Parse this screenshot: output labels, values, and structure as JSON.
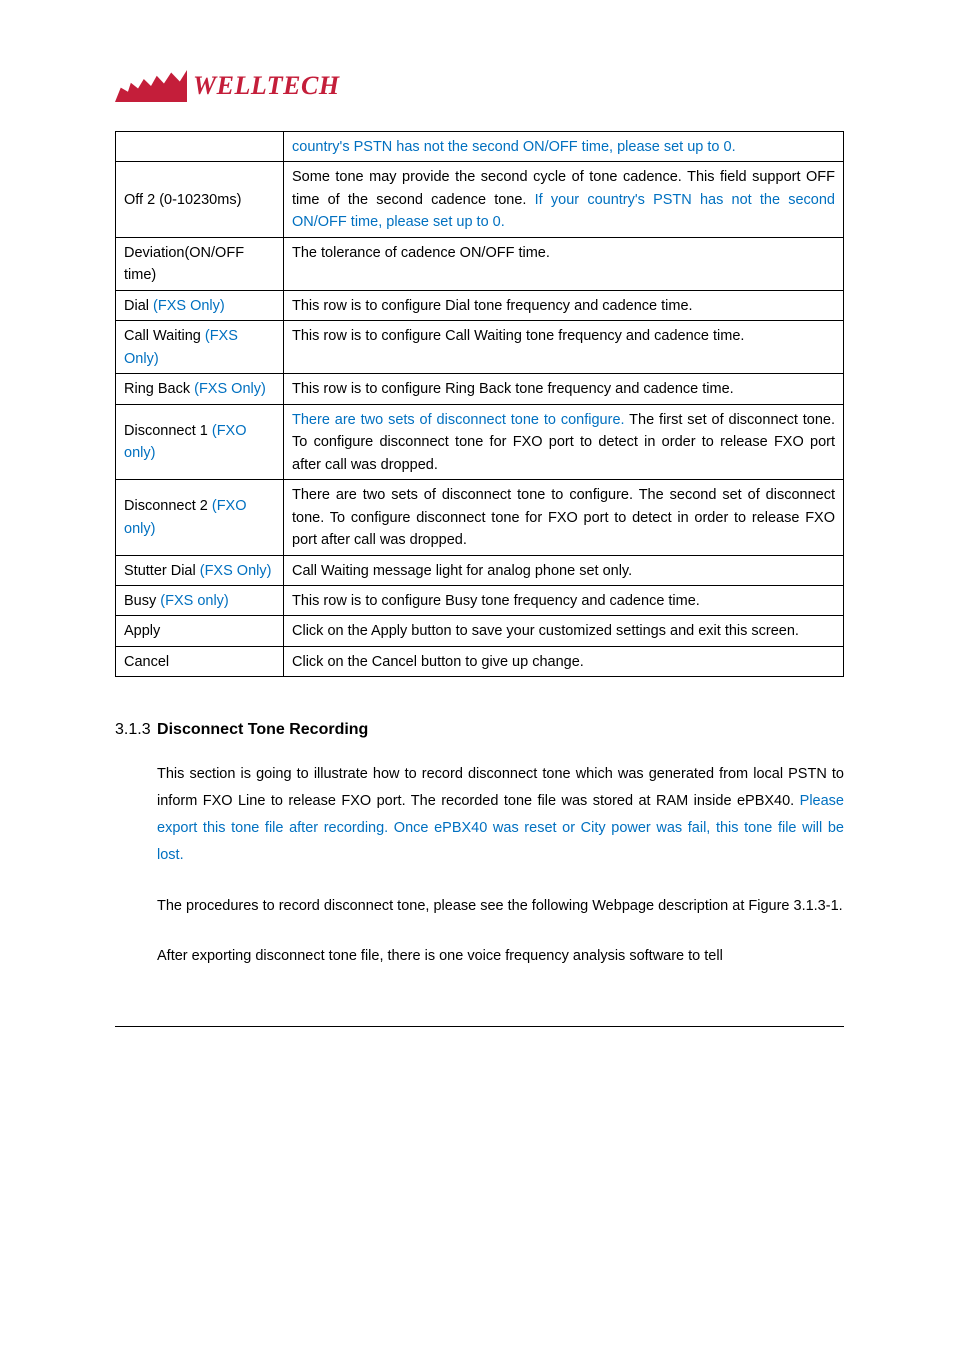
{
  "logo": {
    "text": "WELLTECH"
  },
  "table": {
    "rows": [
      {
        "label_html": "",
        "desc_html": "<span class='blue'>country's PSTN has not the second ON/OFF time, please set up to 0.</span>"
      },
      {
        "label_html": "Off 2 (0-10230ms)",
        "desc_html": "Some tone may provide the second cycle of tone cadence. This field support OFF time of the second cadence tone. <span class='blue'>If your country's PSTN has not the second ON/OFF time, please set up to 0.</span>"
      },
      {
        "label_html": "Deviation(ON/OFF time)",
        "desc_html": "The tolerance of cadence ON/OFF time."
      },
      {
        "label_html": "Dial <span class='blue'>(FXS Only)</span>",
        "desc_html": "This row is to configure Dial tone frequency and cadence time."
      },
      {
        "label_html": "Call Waiting <span class='blue'>(FXS Only)</span>",
        "desc_html": "This row is to configure Call Waiting tone frequency and cadence time."
      },
      {
        "label_html": "Ring Back <span class='blue'>(FXS Only)</span>",
        "desc_html": "This row is to configure Ring Back tone frequency and cadence time."
      },
      {
        "label_html": "Disconnect 1 <span class='blue'>(FXO only)</span>",
        "desc_html": "<span class='blue'>There are two sets of disconnect tone to configure.</span> The first set of disconnect tone. To configure disconnect tone for FXO port to detect in order to release FXO port after call was dropped."
      },
      {
        "label_html": "Disconnect 2 <span class='blue'>(FXO only)</span>",
        "desc_html": "There are two sets of disconnect tone to configure. The second set of disconnect tone. To configure disconnect tone for FXO port to detect in order to release FXO port after call was dropped."
      },
      {
        "label_html": "Stutter Dial <span class='blue'>(FXS Only)</span>",
        "desc_html": "Call Waiting message light for analog phone set only."
      },
      {
        "label_html": "Busy <span class='blue'>(FXS only)</span>",
        "desc_html": "This row is to configure Busy tone frequency and cadence time."
      },
      {
        "label_html": "Apply",
        "desc_html": "Click on the Apply button to save your customized settings and exit this screen."
      },
      {
        "label_html": "Cancel",
        "desc_html": "Click on the Cancel button to give up change."
      }
    ]
  },
  "heading": {
    "num": "3.1.3",
    "title": "Disconnect Tone Recording"
  },
  "para1_html": "This section is going to illustrate how to record disconnect tone which was generated from local PSTN to inform FXO Line to release FXO port. The recorded tone file was stored at RAM inside ePBX40. <span class='blue'>Please export this tone file after recording. Once ePBX40 was reset or City power was fail, this tone file will be lost.</span>",
  "para2": "The procedures to record disconnect tone, please see the following Webpage description at Figure 3.1.3-1.",
  "para3": "After exporting disconnect tone file, there is one voice frequency analysis software to tell"
}
